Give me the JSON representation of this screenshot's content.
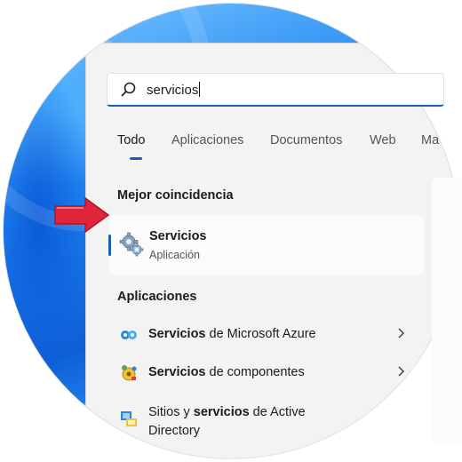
{
  "search": {
    "query": "servicios"
  },
  "tabs": [
    {
      "label": "Todo",
      "active": true
    },
    {
      "label": "Aplicaciones",
      "active": false
    },
    {
      "label": "Documentos",
      "active": false
    },
    {
      "label": "Web",
      "active": false
    },
    {
      "label": "Ma",
      "active": false
    }
  ],
  "best_match": {
    "heading": "Mejor coincidencia",
    "name": "Servicios",
    "type": "Aplicación",
    "icon": "gear-icon"
  },
  "apps": {
    "heading": "Aplicaciones",
    "items": [
      {
        "bold": "Servicios",
        "rest": " de Microsoft Azure",
        "icon": "azure-services-icon",
        "has_chevron": true
      },
      {
        "bold": "Servicios",
        "rest": " de componentes",
        "icon": "component-services-icon",
        "has_chevron": true
      },
      {
        "pre": "Sitios y ",
        "bold": "servicios",
        "rest": " de Active",
        "line2": "Directory",
        "icon": "active-directory-icon",
        "has_chevron": false
      }
    ]
  },
  "colors": {
    "accent": "#1a5fb4",
    "arrow": "#e0253a",
    "panel": "#f3f3f3"
  }
}
